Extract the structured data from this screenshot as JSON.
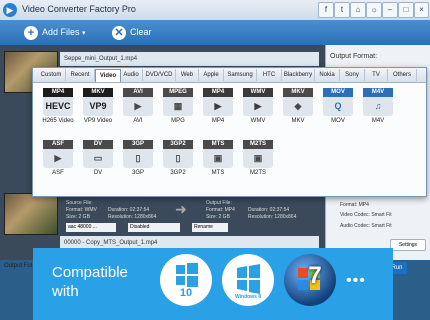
{
  "window": {
    "title": "Video Converter Factory Pro",
    "app_icon": "converter-app-icon"
  },
  "toolbar": {
    "add_files": "Add Files",
    "clear": "Clear"
  },
  "files": [
    {
      "name": "Seppe_mini_Output_1.mp4"
    },
    {
      "name": "00000 - Copy_MTS_Output_1.mp4"
    }
  ],
  "file_info": {
    "source_label": "Source File:",
    "source_format": "Format: WMV",
    "source_size": "Size: 2 GB",
    "source_duration": "Duration: 02:37:54",
    "source_resolution": "Resolution: 1280x864",
    "output_label": "Output File:",
    "output_format": "Format: MP4",
    "output_size": "Size: 2 GB",
    "output_duration": "Duration: 02:37:54",
    "output_resolution": "Resolution: 1280x864",
    "audio_select": "aac 48000 ...",
    "subtitle_select": "Disabled",
    "rename": "Rename"
  },
  "right_panel": {
    "heading": "Output Format:",
    "format": "Format: MP4",
    "video_codec": "Video Codec: Smart Fit",
    "audio_codec": "Audio Codec: Smart Fit",
    "settings": "Settings"
  },
  "output_folder": "Output Fol",
  "convert": "Run",
  "tabs": [
    "Custom",
    "Recent",
    "Video",
    "Audio",
    "DVD/VCD",
    "Web",
    "Apple",
    "Samsung",
    "HTC",
    "Blackberry",
    "Nokia",
    "Sony",
    "TV",
    "Others"
  ],
  "active_tab": "Video",
  "formats": [
    {
      "top": "MP4",
      "glyph": "HEVC",
      "label": "H265 Video",
      "color": "#1d1d1d"
    },
    {
      "top": "MKV",
      "glyph": "VP9",
      "label": "VP9 Video",
      "color": "#1d1d1d"
    },
    {
      "top": "AVI",
      "glyph": "▶",
      "label": "AVI",
      "color": "#4a4a4a"
    },
    {
      "top": "MPEG",
      "glyph": "▦",
      "label": "MPG",
      "color": "#4a4a4a"
    },
    {
      "top": "MP4",
      "glyph": "▶",
      "label": "MP4",
      "color": "#3a3a3a"
    },
    {
      "top": "WMV",
      "glyph": "▶",
      "label": "WMV",
      "color": "#3a3a3a"
    },
    {
      "top": "MKV",
      "glyph": "◆",
      "label": "MKV",
      "color": "#4a4a4a"
    },
    {
      "top": "MOV",
      "glyph": "Q",
      "label": "MOV",
      "color": "#2d6fb5"
    },
    {
      "top": "M4V",
      "glyph": "♫",
      "label": "M4V",
      "color": "#2d6fb5"
    },
    {
      "top": "ASF",
      "glyph": "▶",
      "label": "ASF",
      "color": "#4a4a4a"
    },
    {
      "top": "DV",
      "glyph": "▭",
      "label": "DV",
      "color": "#4a4a4a"
    },
    {
      "top": "3GP",
      "glyph": "▯",
      "label": "3GP",
      "color": "#4a4a4a"
    },
    {
      "top": "3GP2",
      "glyph": "▯",
      "label": "3GP2",
      "color": "#4a4a4a"
    },
    {
      "top": "MTS",
      "glyph": "▣",
      "label": "MTS",
      "color": "#4a4a4a"
    },
    {
      "top": "M2TS",
      "glyph": "▣",
      "label": "M2TS",
      "color": "#4a4a4a"
    }
  ],
  "banner": {
    "text": "Compatible with",
    "os_10": "10",
    "os_8": "Windows 8",
    "os_7": "7",
    "more": "•••"
  }
}
